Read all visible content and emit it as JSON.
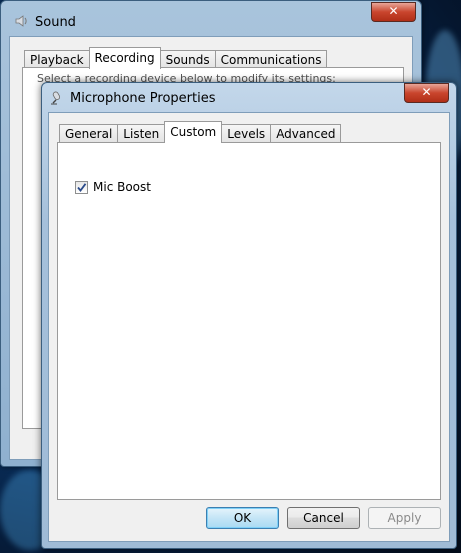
{
  "sound_window": {
    "title": "Sound",
    "close_label": "✕",
    "tabs": [
      {
        "label": "Playback"
      },
      {
        "label": "Recording"
      },
      {
        "label": "Sounds"
      },
      {
        "label": "Communications"
      }
    ],
    "active_tab": "Recording",
    "partial_text": "Select a recording device below to modify its settings:"
  },
  "mic_window": {
    "title": "Microphone Properties",
    "close_label": "✕",
    "tabs": [
      {
        "label": "General"
      },
      {
        "label": "Listen"
      },
      {
        "label": "Custom"
      },
      {
        "label": "Levels"
      },
      {
        "label": "Advanced"
      }
    ],
    "active_tab": "Custom",
    "mic_boost": {
      "label": "Mic Boost",
      "checked": true
    },
    "buttons": {
      "ok": "OK",
      "cancel": "Cancel",
      "apply": "Apply"
    }
  },
  "icons": {
    "sound_window": "speaker-icon",
    "mic_window": "microphone-icon"
  },
  "colors": {
    "close_button": "#c9452d",
    "window_frame": "#a5c0db",
    "default_button_border": "#3c7fb1"
  }
}
